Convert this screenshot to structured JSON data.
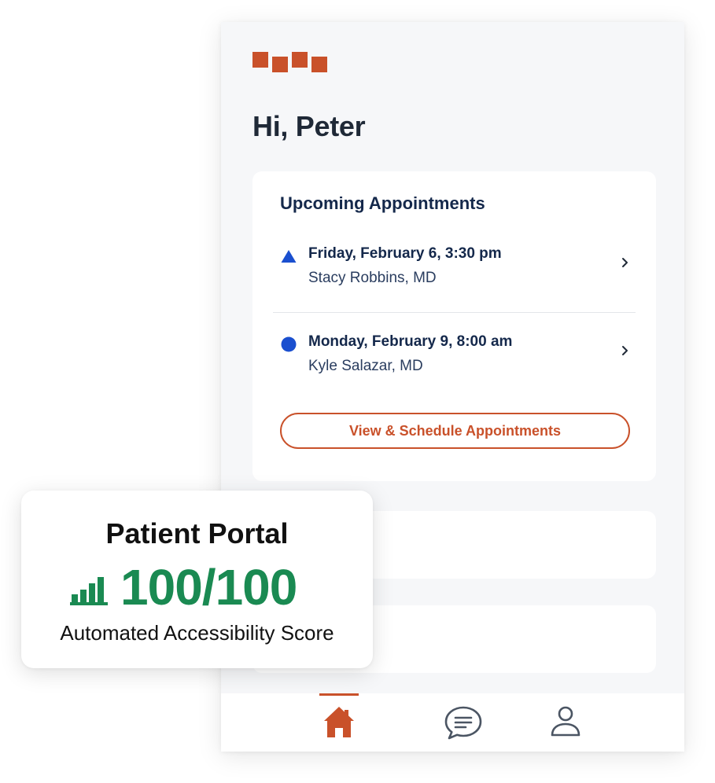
{
  "header": {
    "logo_icon": "brand-logo-blocks",
    "greeting": "Hi, Peter"
  },
  "appointments": {
    "title": "Upcoming Appointments",
    "items": [
      {
        "marker": "triangle-icon",
        "date": "Friday, February 6, 3:30 pm",
        "doctor": "Stacy Robbins, MD"
      },
      {
        "marker": "circle-icon",
        "date": "Monday, February 9, 8:00 am",
        "doctor": "Kyle Salazar, MD"
      }
    ],
    "button_label": "View & Schedule Appointments"
  },
  "bottom_nav": {
    "items": [
      {
        "icon": "home-icon",
        "active": true
      },
      {
        "icon": "chat-icon",
        "active": false
      },
      {
        "icon": "profile-icon",
        "active": false
      }
    ]
  },
  "score_card": {
    "title": "Patient Portal",
    "icon": "signal-bars-icon",
    "score": "100/100",
    "label": "Automated Accessibility Score"
  },
  "colors": {
    "brand": "#c9512a",
    "navy": "#14284b",
    "marker_blue": "#1a4fcf",
    "score_green": "#1a8a52",
    "background": "#f6f7f9"
  }
}
